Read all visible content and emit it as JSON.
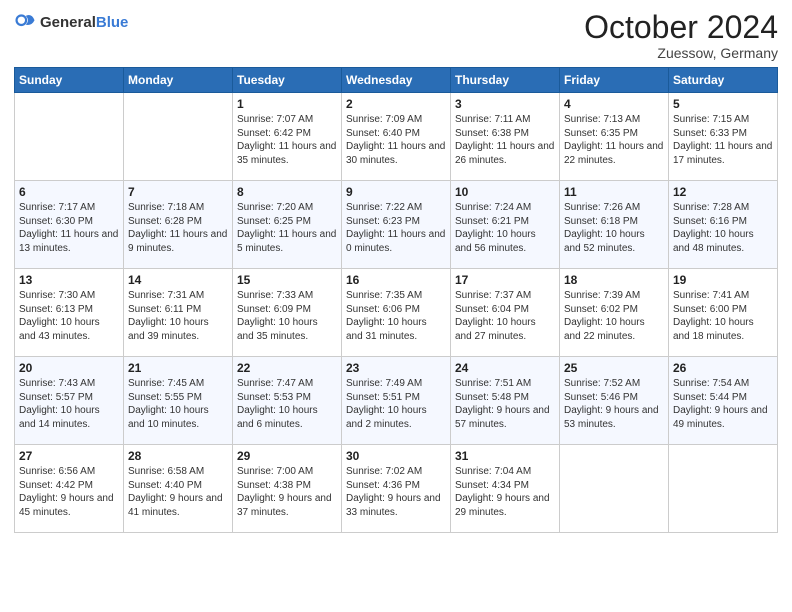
{
  "header": {
    "logo_general": "General",
    "logo_blue": "Blue",
    "month_title": "October 2024",
    "location": "Zuessow, Germany"
  },
  "days_of_week": [
    "Sunday",
    "Monday",
    "Tuesday",
    "Wednesday",
    "Thursday",
    "Friday",
    "Saturday"
  ],
  "weeks": [
    [
      {
        "day": "",
        "content": ""
      },
      {
        "day": "",
        "content": ""
      },
      {
        "day": "1",
        "content": "Sunrise: 7:07 AM\nSunset: 6:42 PM\nDaylight: 11 hours and 35 minutes."
      },
      {
        "day": "2",
        "content": "Sunrise: 7:09 AM\nSunset: 6:40 PM\nDaylight: 11 hours and 30 minutes."
      },
      {
        "day": "3",
        "content": "Sunrise: 7:11 AM\nSunset: 6:38 PM\nDaylight: 11 hours and 26 minutes."
      },
      {
        "day": "4",
        "content": "Sunrise: 7:13 AM\nSunset: 6:35 PM\nDaylight: 11 hours and 22 minutes."
      },
      {
        "day": "5",
        "content": "Sunrise: 7:15 AM\nSunset: 6:33 PM\nDaylight: 11 hours and 17 minutes."
      }
    ],
    [
      {
        "day": "6",
        "content": "Sunrise: 7:17 AM\nSunset: 6:30 PM\nDaylight: 11 hours and 13 minutes."
      },
      {
        "day": "7",
        "content": "Sunrise: 7:18 AM\nSunset: 6:28 PM\nDaylight: 11 hours and 9 minutes."
      },
      {
        "day": "8",
        "content": "Sunrise: 7:20 AM\nSunset: 6:25 PM\nDaylight: 11 hours and 5 minutes."
      },
      {
        "day": "9",
        "content": "Sunrise: 7:22 AM\nSunset: 6:23 PM\nDaylight: 11 hours and 0 minutes."
      },
      {
        "day": "10",
        "content": "Sunrise: 7:24 AM\nSunset: 6:21 PM\nDaylight: 10 hours and 56 minutes."
      },
      {
        "day": "11",
        "content": "Sunrise: 7:26 AM\nSunset: 6:18 PM\nDaylight: 10 hours and 52 minutes."
      },
      {
        "day": "12",
        "content": "Sunrise: 7:28 AM\nSunset: 6:16 PM\nDaylight: 10 hours and 48 minutes."
      }
    ],
    [
      {
        "day": "13",
        "content": "Sunrise: 7:30 AM\nSunset: 6:13 PM\nDaylight: 10 hours and 43 minutes."
      },
      {
        "day": "14",
        "content": "Sunrise: 7:31 AM\nSunset: 6:11 PM\nDaylight: 10 hours and 39 minutes."
      },
      {
        "day": "15",
        "content": "Sunrise: 7:33 AM\nSunset: 6:09 PM\nDaylight: 10 hours and 35 minutes."
      },
      {
        "day": "16",
        "content": "Sunrise: 7:35 AM\nSunset: 6:06 PM\nDaylight: 10 hours and 31 minutes."
      },
      {
        "day": "17",
        "content": "Sunrise: 7:37 AM\nSunset: 6:04 PM\nDaylight: 10 hours and 27 minutes."
      },
      {
        "day": "18",
        "content": "Sunrise: 7:39 AM\nSunset: 6:02 PM\nDaylight: 10 hours and 22 minutes."
      },
      {
        "day": "19",
        "content": "Sunrise: 7:41 AM\nSunset: 6:00 PM\nDaylight: 10 hours and 18 minutes."
      }
    ],
    [
      {
        "day": "20",
        "content": "Sunrise: 7:43 AM\nSunset: 5:57 PM\nDaylight: 10 hours and 14 minutes."
      },
      {
        "day": "21",
        "content": "Sunrise: 7:45 AM\nSunset: 5:55 PM\nDaylight: 10 hours and 10 minutes."
      },
      {
        "day": "22",
        "content": "Sunrise: 7:47 AM\nSunset: 5:53 PM\nDaylight: 10 hours and 6 minutes."
      },
      {
        "day": "23",
        "content": "Sunrise: 7:49 AM\nSunset: 5:51 PM\nDaylight: 10 hours and 2 minutes."
      },
      {
        "day": "24",
        "content": "Sunrise: 7:51 AM\nSunset: 5:48 PM\nDaylight: 9 hours and 57 minutes."
      },
      {
        "day": "25",
        "content": "Sunrise: 7:52 AM\nSunset: 5:46 PM\nDaylight: 9 hours and 53 minutes."
      },
      {
        "day": "26",
        "content": "Sunrise: 7:54 AM\nSunset: 5:44 PM\nDaylight: 9 hours and 49 minutes."
      }
    ],
    [
      {
        "day": "27",
        "content": "Sunrise: 6:56 AM\nSunset: 4:42 PM\nDaylight: 9 hours and 45 minutes."
      },
      {
        "day": "28",
        "content": "Sunrise: 6:58 AM\nSunset: 4:40 PM\nDaylight: 9 hours and 41 minutes."
      },
      {
        "day": "29",
        "content": "Sunrise: 7:00 AM\nSunset: 4:38 PM\nDaylight: 9 hours and 37 minutes."
      },
      {
        "day": "30",
        "content": "Sunrise: 7:02 AM\nSunset: 4:36 PM\nDaylight: 9 hours and 33 minutes."
      },
      {
        "day": "31",
        "content": "Sunrise: 7:04 AM\nSunset: 4:34 PM\nDaylight: 9 hours and 29 minutes."
      },
      {
        "day": "",
        "content": ""
      },
      {
        "day": "",
        "content": ""
      }
    ]
  ]
}
